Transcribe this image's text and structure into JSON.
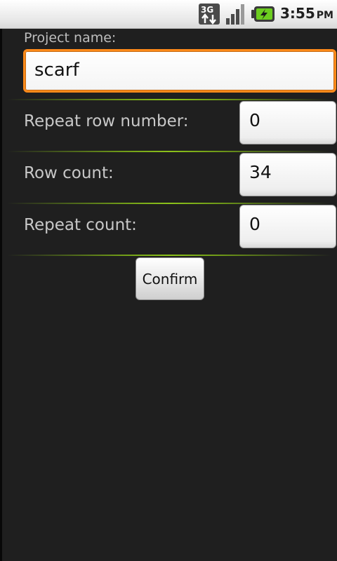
{
  "status_bar": {
    "network_label": "3G",
    "network_icon": "network-3g-icon",
    "signal_icon": "signal-strength-icon",
    "battery_icon": "battery-charging-icon",
    "time": "3:55",
    "ampm": "PM"
  },
  "form": {
    "project_name_label": "Project name:",
    "project_name_value": "scarf",
    "repeat_row_number_label": "Repeat row number:",
    "repeat_row_number_value": "0",
    "row_count_label": "Row count:",
    "row_count_value": "34",
    "repeat_count_label": "Repeat count:",
    "repeat_count_value": "0",
    "confirm_label": "Confirm"
  },
  "colors": {
    "background": "#1f1f1f",
    "focus_border": "#ff8a1a",
    "divider_accent": "#8cc21a",
    "label_text": "#c8c8c8"
  }
}
